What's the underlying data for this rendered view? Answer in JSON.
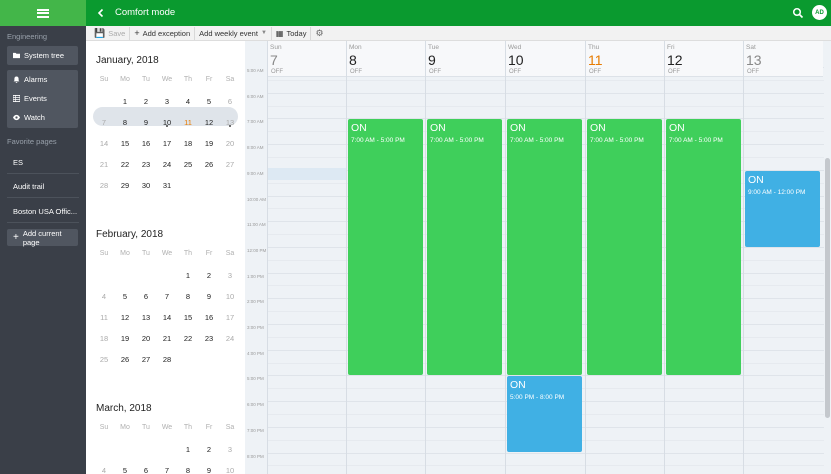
{
  "header": {
    "title": "Comfort mode",
    "avatar_initials": "AD"
  },
  "sidebar": {
    "section_label": "Engineering",
    "system_tree": "System tree",
    "group_items": [
      "Alarms",
      "Events",
      "Watch"
    ],
    "favorites_label": "Favorite pages",
    "favorites": [
      "ES",
      "Audit trail",
      "Boston USA Offic..."
    ],
    "add_page": "Add current page"
  },
  "toolbar": {
    "save": "Save",
    "add_exception": "Add exception",
    "add_weekly_event": "Add weekly event",
    "today": "Today"
  },
  "minicalendars": [
    {
      "title": "January, 2018",
      "days": [
        [
          null,
          "1",
          "2",
          "3",
          "4",
          "5",
          "6"
        ],
        [
          "7",
          "8",
          "9",
          "10",
          "11",
          "12",
          "13"
        ],
        [
          "14",
          "15",
          "16",
          "17",
          "18",
          "19",
          "20"
        ],
        [
          "21",
          "22",
          "23",
          "24",
          "25",
          "26",
          "27"
        ],
        [
          "28",
          "29",
          "30",
          "31",
          null,
          null,
          null
        ]
      ]
    },
    {
      "title": "February, 2018",
      "days": [
        [
          null,
          null,
          null,
          null,
          "1",
          "2",
          "3"
        ],
        [
          "4",
          "5",
          "6",
          "7",
          "8",
          "9",
          "10"
        ],
        [
          "11",
          "12",
          "13",
          "14",
          "15",
          "16",
          "17"
        ],
        [
          "18",
          "19",
          "20",
          "21",
          "22",
          "23",
          "24"
        ],
        [
          "25",
          "26",
          "27",
          "28",
          null,
          null,
          null
        ]
      ]
    },
    {
      "title": "March, 2018",
      "days": [
        [
          null,
          null,
          null,
          null,
          "1",
          "2",
          "3"
        ],
        [
          "4",
          "5",
          "6",
          "7",
          "8",
          "9",
          "10"
        ]
      ]
    }
  ],
  "weekday_short": [
    "Su",
    "Mo",
    "Tu",
    "We",
    "Th",
    "Fr",
    "Sa"
  ],
  "schedule": {
    "days": [
      {
        "name": "Sun",
        "num": "7",
        "off": "OFF"
      },
      {
        "name": "Mon",
        "num": "8",
        "off": "OFF"
      },
      {
        "name": "Tue",
        "num": "9",
        "off": "OFF"
      },
      {
        "name": "Wed",
        "num": "10",
        "off": "OFF"
      },
      {
        "name": "Thu",
        "num": "11",
        "off": "OFF"
      },
      {
        "name": "Fri",
        "num": "12",
        "off": "OFF"
      },
      {
        "name": "Sat",
        "num": "13",
        "off": "OFF"
      }
    ],
    "times": [
      "5:00 AM",
      "6:00 AM",
      "7:00 AM",
      "8:00 AM",
      "9:00 AM",
      "10:00 AM",
      "11:00 AM",
      "12:00 PM",
      "1:00 PM",
      "2:00 PM",
      "3:00 PM",
      "4:00 PM",
      "5:00 PM",
      "6:00 PM",
      "7:00 PM",
      "8:00 PM"
    ],
    "events": [
      {
        "day": 1,
        "title": "ON",
        "time": "7:00 AM - 5:00 PM",
        "color": "green"
      },
      {
        "day": 2,
        "title": "ON",
        "time": "7:00 AM - 5:00 PM",
        "color": "green"
      },
      {
        "day": 3,
        "title": "ON",
        "time": "7:00 AM - 5:00 PM",
        "color": "green"
      },
      {
        "day": 4,
        "title": "ON",
        "time": "7:00 AM - 5:00 PM",
        "color": "green"
      },
      {
        "day": 5,
        "title": "ON",
        "time": "7:00 AM - 5:00 PM",
        "color": "green"
      },
      {
        "day": 6,
        "title": "ON",
        "time": "9:00 AM - 12:00 PM",
        "color": "blue"
      },
      {
        "day": 3,
        "title": "ON",
        "time": "5:00 PM - 8:00 PM",
        "color": "blue"
      }
    ]
  },
  "colors": {
    "header": "#0a9a2f",
    "accent": "#43b649",
    "event_green": "#3fcf5b",
    "event_blue": "#40b0e4",
    "today": "#e77b00"
  }
}
